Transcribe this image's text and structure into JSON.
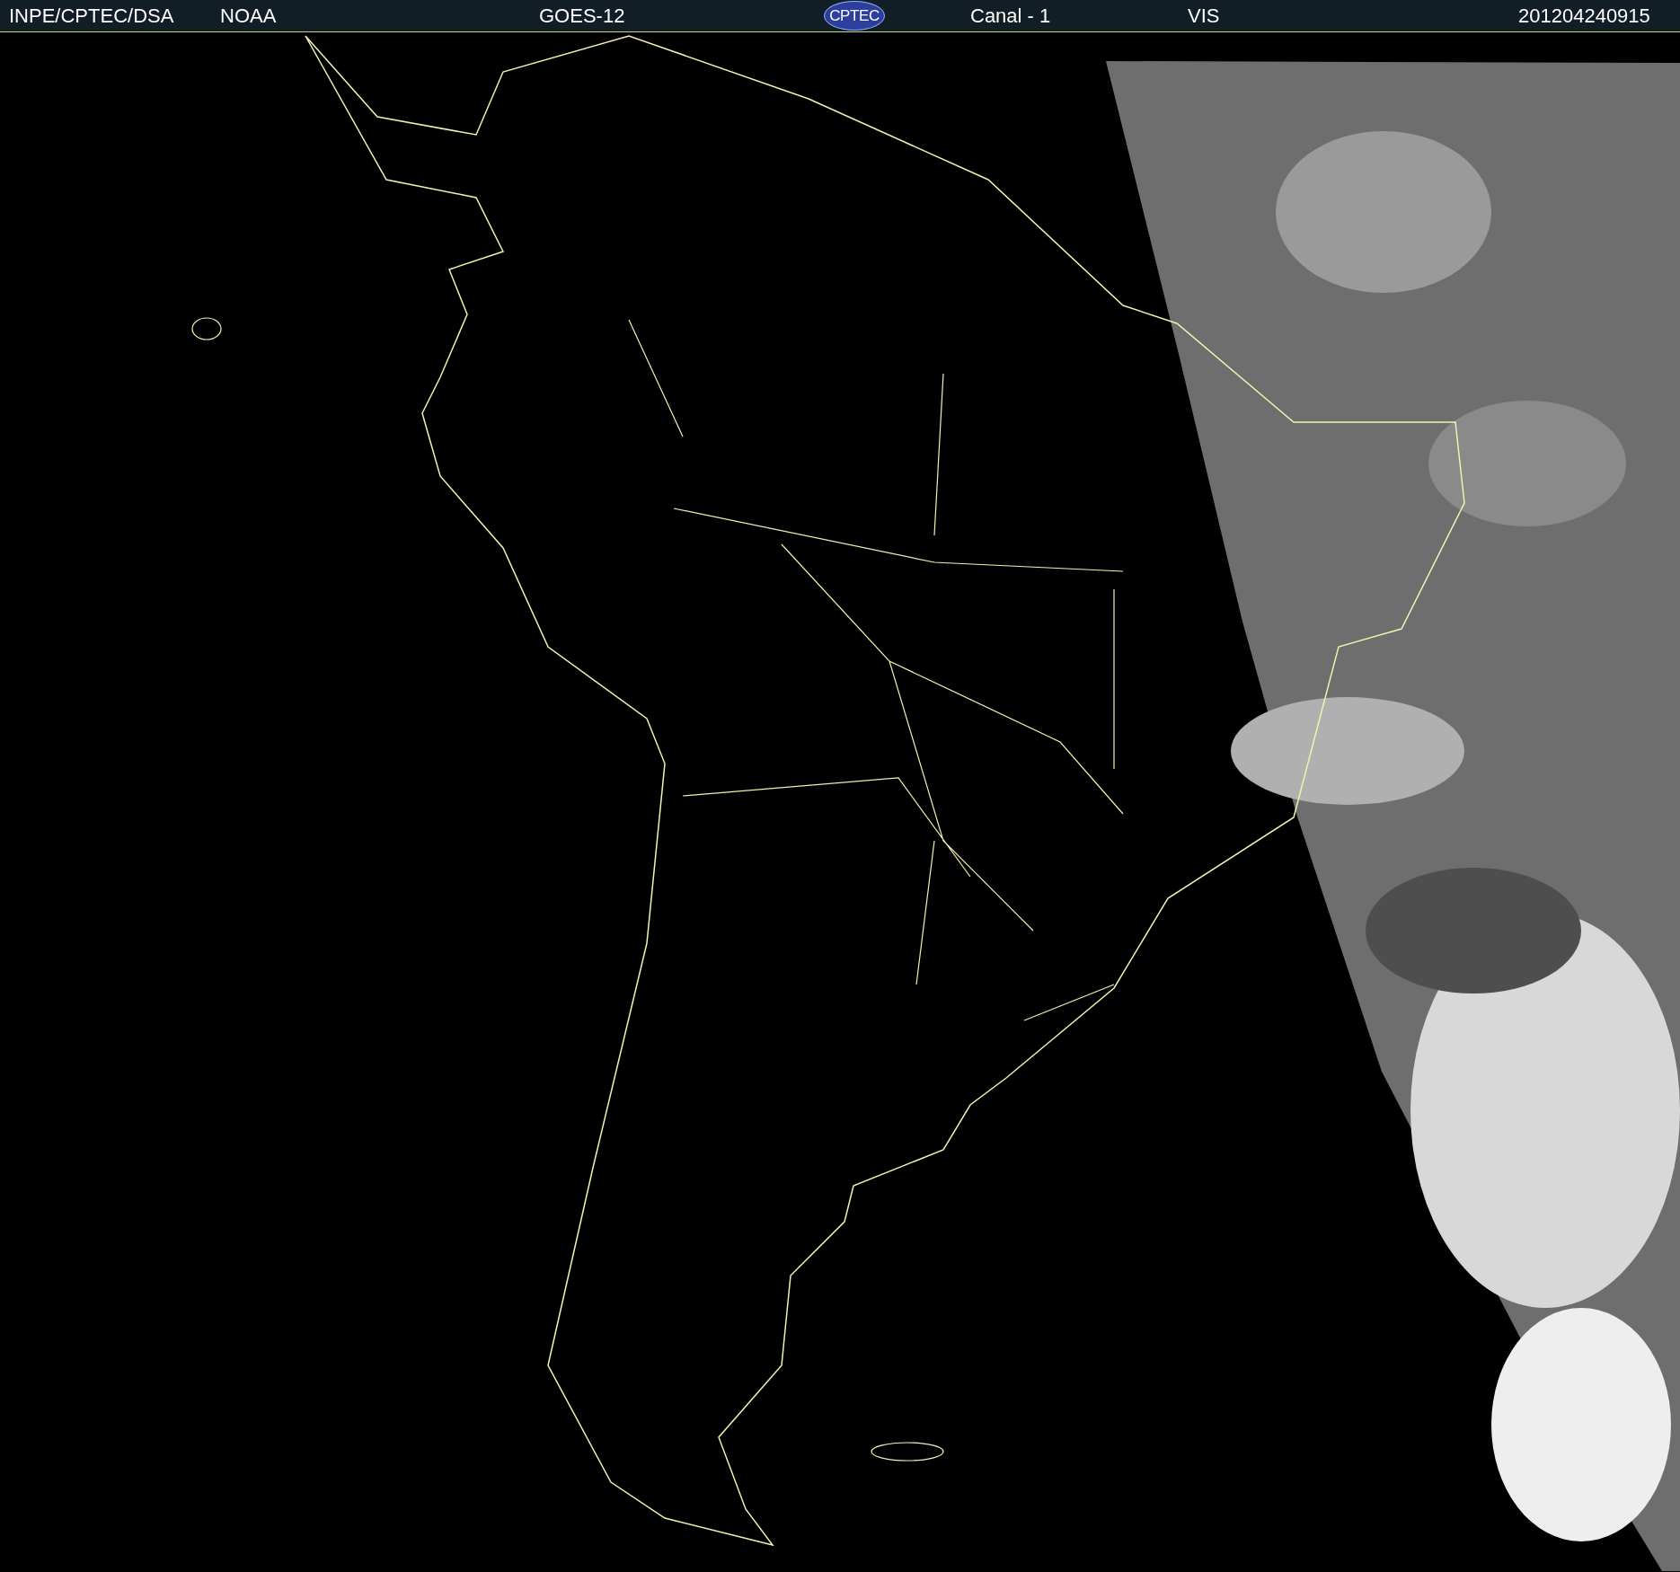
{
  "header": {
    "items": [
      {
        "kind": "text",
        "label": "INPE/CPTEC/DSA"
      },
      {
        "kind": "text",
        "label": "NOAA"
      },
      {
        "kind": "text",
        "label": "GOES-12"
      },
      {
        "kind": "logo",
        "label": "CPTEC"
      },
      {
        "kind": "text",
        "label": "Canal - 1"
      },
      {
        "kind": "text",
        "label": "VIS"
      },
      {
        "kind": "text",
        "label": "201204240915"
      }
    ]
  }
}
